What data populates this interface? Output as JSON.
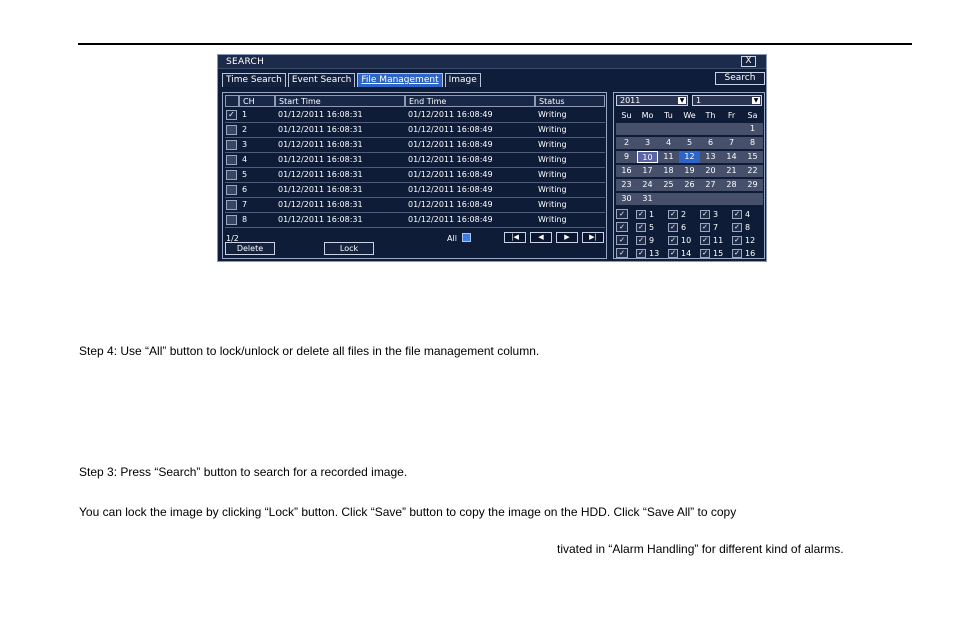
{
  "window": {
    "title": "SEARCH",
    "close_label": "X",
    "tabs": [
      "Time Search",
      "Event Search",
      "File Management",
      "Image"
    ],
    "active_tab": "File Management",
    "search_label": "Search"
  },
  "table": {
    "headers": [
      "CH",
      "Start Time",
      "End Time",
      "Status"
    ],
    "rows": [
      {
        "checked": true,
        "ch": "1",
        "start": "01/12/2011 16:08:31",
        "end": "01/12/2011 16:08:49",
        "status": "Writing"
      },
      {
        "checked": false,
        "ch": "2",
        "start": "01/12/2011 16:08:31",
        "end": "01/12/2011 16:08:49",
        "status": "Writing"
      },
      {
        "checked": false,
        "ch": "3",
        "start": "01/12/2011 16:08:31",
        "end": "01/12/2011 16:08:49",
        "status": "Writing"
      },
      {
        "checked": false,
        "ch": "4",
        "start": "01/12/2011 16:08:31",
        "end": "01/12/2011 16:08:49",
        "status": "Writing"
      },
      {
        "checked": false,
        "ch": "5",
        "start": "01/12/2011 16:08:31",
        "end": "01/12/2011 16:08:49",
        "status": "Writing"
      },
      {
        "checked": false,
        "ch": "6",
        "start": "01/12/2011 16:08:31",
        "end": "01/12/2011 16:08:49",
        "status": "Writing"
      },
      {
        "checked": false,
        "ch": "7",
        "start": "01/12/2011 16:08:31",
        "end": "01/12/2011 16:08:49",
        "status": "Writing"
      },
      {
        "checked": false,
        "ch": "8",
        "start": "01/12/2011 16:08:31",
        "end": "01/12/2011 16:08:49",
        "status": "Writing"
      }
    ],
    "page": "1/2",
    "all_label": "All",
    "nav": [
      "|◀",
      "◀",
      "▶",
      "▶|"
    ],
    "delete_label": "Delete",
    "lock_label": "Lock"
  },
  "calendar": {
    "year": "2011",
    "month": "1",
    "weekdays": [
      "Su",
      "Mo",
      "Tu",
      "We",
      "Th",
      "Fr",
      "Sa"
    ],
    "weeks": [
      [
        "",
        "",
        "",
        "",
        "",
        "",
        "1"
      ],
      [
        "2",
        "3",
        "4",
        "5",
        "6",
        "7",
        "8"
      ],
      [
        "9",
        "10",
        "11",
        "12",
        "13",
        "14",
        "15"
      ],
      [
        "16",
        "17",
        "18",
        "19",
        "20",
        "21",
        "22"
      ],
      [
        "23",
        "24",
        "25",
        "26",
        "27",
        "28",
        "29"
      ],
      [
        "30",
        "31",
        "",
        "",
        "",
        "",
        ""
      ]
    ],
    "marked_day": "10",
    "selected_day": "12",
    "channels": [
      "1",
      "2",
      "3",
      "4",
      "5",
      "6",
      "7",
      "8",
      "9",
      "10",
      "11",
      "12",
      "13",
      "14",
      "15",
      "16"
    ]
  },
  "doc": {
    "line1": "Step 4: Use “All” button to lock/unlock or delete all files in the file management column.",
    "arrows": [
      "",
      ""
    ],
    "line2": "Step 3: Press “Search” button to search for a recorded image.",
    "line3": "You can lock the image by clicking “Lock” button. Click “Save” button to copy the image on the HDD. Click “Save All” to copy",
    "line4": "tivated in “Alarm Handling” for different kind of alarms."
  }
}
